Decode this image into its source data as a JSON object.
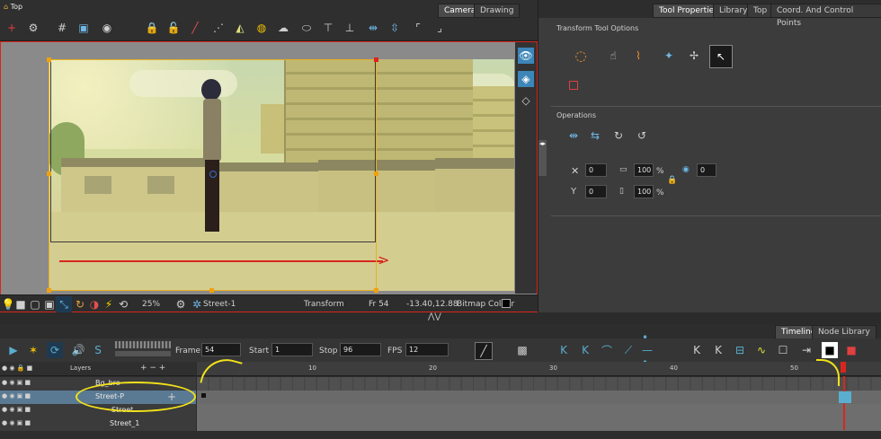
{
  "camera_view": {
    "title": "Top",
    "tabs": [
      "Camera",
      "Drawing"
    ],
    "status": {
      "zoom": "25%",
      "layer": "Street-1",
      "tool": "Transform",
      "frame": "Fr 54",
      "coords": "-13.40,12.88",
      "mode": "Bitmap Colour"
    }
  },
  "right_panel": {
    "tabs": [
      "Tool Properties",
      "Library",
      "Top",
      "Coord. And Control Points"
    ],
    "transform_options_title": "Transform Tool Options",
    "operations_title": "Operations",
    "x_value": "0",
    "y_value": "0",
    "width_value": "100",
    "height_value": "100",
    "angle_value": "0",
    "pct1": "%",
    "pct2": "%"
  },
  "timeline": {
    "tabs": [
      "Timeline",
      "Node Library"
    ],
    "frame_label": "Frame",
    "frame_value": "54",
    "start_label": "Start",
    "start_value": "1",
    "stop_label": "Stop",
    "stop_value": "96",
    "fps_label": "FPS",
    "fps_value": "12",
    "layers_label": "Layers",
    "ruler_ticks": [
      "10",
      "20",
      "30",
      "40",
      "50"
    ],
    "layers": [
      {
        "name": "Bg_bro"
      },
      {
        "name": "Street-P"
      },
      {
        "name": "Street"
      },
      {
        "name": "Street_1"
      }
    ]
  },
  "colors": {
    "accent_red": "#d9261c",
    "highlight_yellow": "#f2e21a",
    "selected_blue": "#5aaed0"
  }
}
